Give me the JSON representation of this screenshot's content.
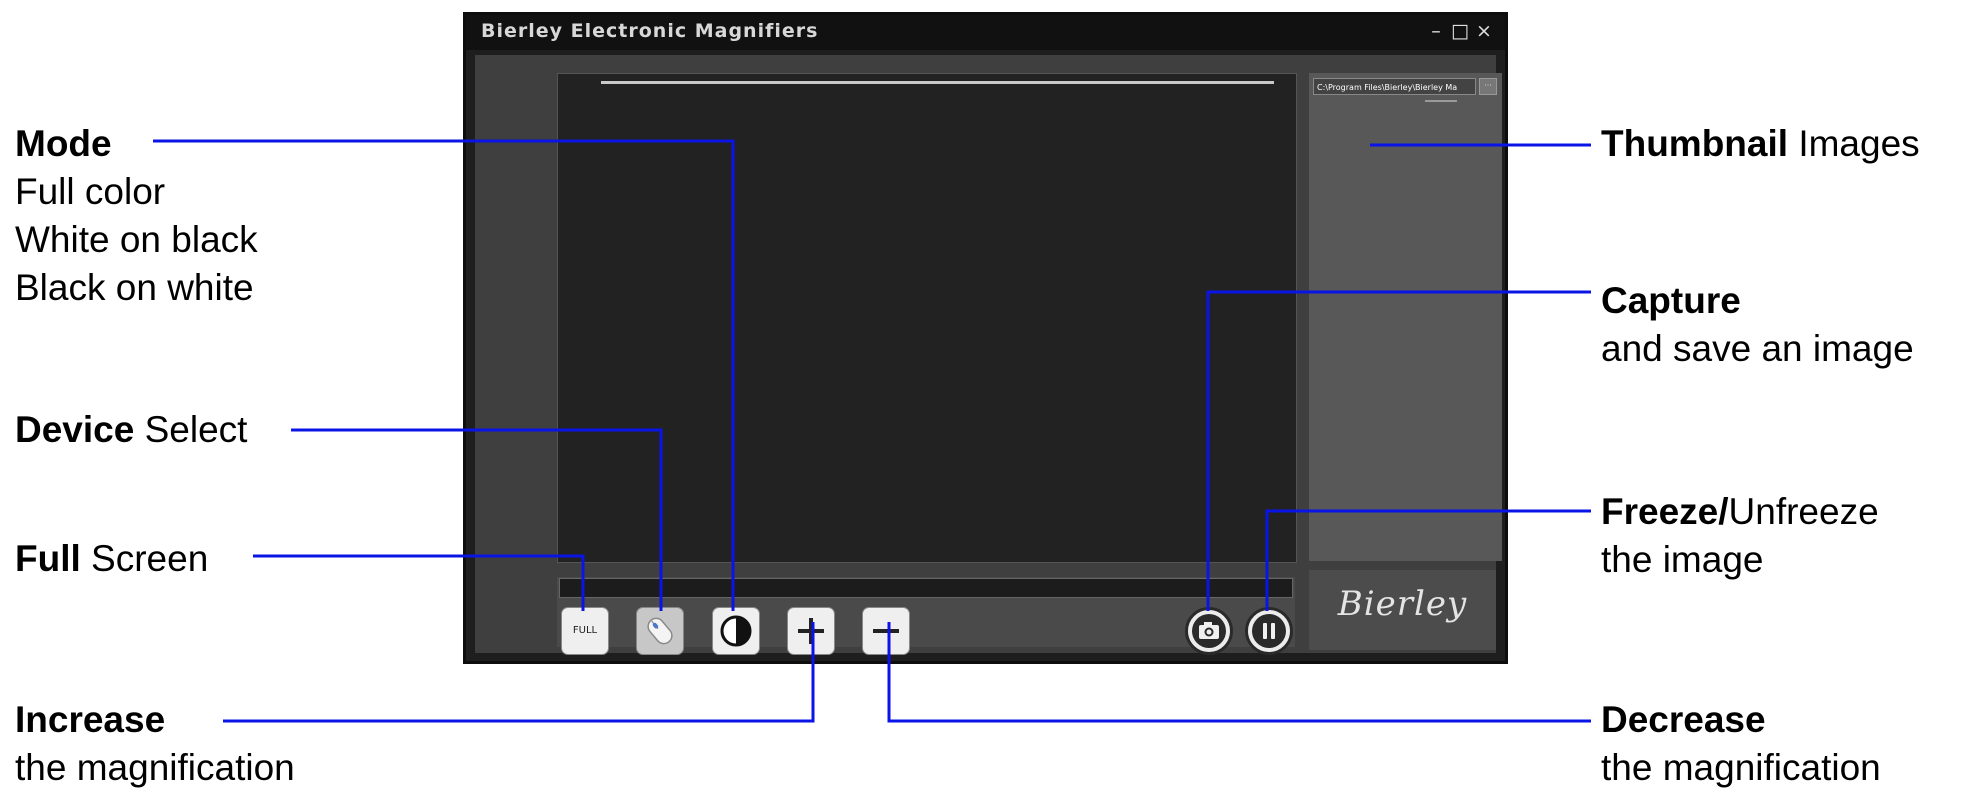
{
  "window": {
    "title": "Bierley Electronic Magnifiers",
    "controls": {
      "minimize": "–",
      "maximize": "□",
      "close": "×"
    },
    "path_field": "C:\\Program Files\\Bierley\\Bierley Ma",
    "path_button": "···",
    "brand": "Bierley",
    "buttons": {
      "full_screen": "FULL",
      "device_select_icon": "mouse-icon",
      "mode_icon": "contrast-icon",
      "increase_icon": "plus-icon",
      "decrease_icon": "minus-icon",
      "capture_icon": "camera-icon",
      "freeze_icon": "pause-icon"
    }
  },
  "annotations": {
    "mode": {
      "title": "Mode",
      "lines": [
        "Full color",
        "White on black",
        "Black on white"
      ]
    },
    "device": {
      "bold": "Device",
      "rest": " Select"
    },
    "full": {
      "bold": "Full",
      "rest": " Screen"
    },
    "increase": {
      "title": "Increase",
      "sub": "the magnification"
    },
    "thumbnail": {
      "bold": "Thumbnail",
      "rest": " Images"
    },
    "capture": {
      "title": "Capture",
      "sub": "and save an image"
    },
    "freeze": {
      "bold": "Freeze/",
      "rest": "Unfreeze",
      "sub": "the image"
    },
    "decrease": {
      "title": "Decrease",
      "sub": "the magnification"
    }
  },
  "colors": {
    "leader": "#0a14e6",
    "window_bg": "#1e1e1e",
    "panel_bg": "#3f3f3f"
  }
}
